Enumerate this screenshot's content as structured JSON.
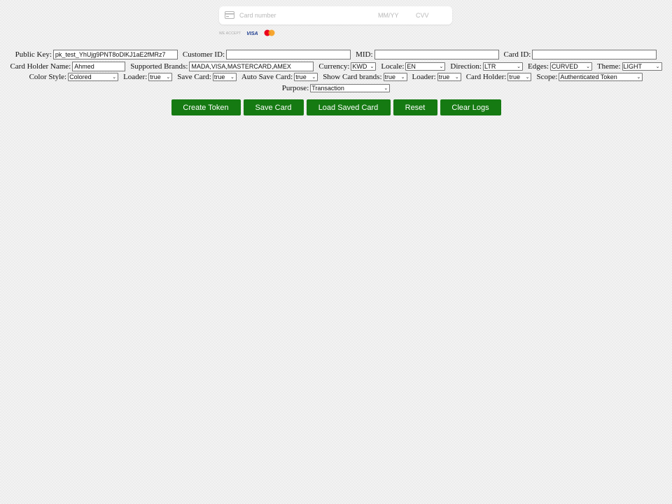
{
  "card_widget": {
    "card_number_placeholder": "Card number",
    "expiry_placeholder": "MM/YY",
    "cvv_placeholder": "CVV",
    "we_accept": "WE ACCEPT",
    "visa": "VISA"
  },
  "form": {
    "public_key": {
      "label": "Public Key:",
      "value": "pk_test_YhUjg9PNT8oDlKJ1aE2fMRz7"
    },
    "customer_id": {
      "label": "Customer ID:",
      "value": ""
    },
    "mid": {
      "label": "MID:",
      "value": ""
    },
    "card_id": {
      "label": "Card ID:",
      "value": ""
    },
    "card_holder_name": {
      "label": "Card Holder Name:",
      "value": "Ahmed"
    },
    "supported_brands": {
      "label": "Supported Brands:",
      "value": "MADA,VISA,MASTERCARD,AMEX"
    },
    "currency": {
      "label": "Currency:",
      "value": "KWD"
    },
    "locale": {
      "label": "Locale:",
      "value": "EN"
    },
    "direction": {
      "label": "Direction:",
      "value": "LTR"
    },
    "edges": {
      "label": "Edges:",
      "value": "CURVED"
    },
    "theme": {
      "label": "Theme:",
      "value": "LIGHT"
    },
    "color_style": {
      "label": "Color Style:",
      "value": "Colored"
    },
    "loader": {
      "label": "Loader:",
      "value": "true"
    },
    "save_card": {
      "label": "Save Card:",
      "value": "true"
    },
    "auto_save_card": {
      "label": "Auto Save Card:",
      "value": "true"
    },
    "show_card_brands": {
      "label": "Show Card brands:",
      "value": "true"
    },
    "loader2": {
      "label": "Loader:",
      "value": "true"
    },
    "card_holder": {
      "label": "Card Holder:",
      "value": "true"
    },
    "scope": {
      "label": "Scope:",
      "value": "Authenticated Token"
    },
    "purpose": {
      "label": "Purpose:",
      "value": "Transaction"
    }
  },
  "buttons": {
    "create_token": "Create Token",
    "save_card": "Save Card",
    "load_saved_card": "Load Saved Card",
    "reset": "Reset",
    "clear_logs": "Clear Logs"
  },
  "colors": {
    "button_bg": "#157a12",
    "background": "#ececec"
  }
}
